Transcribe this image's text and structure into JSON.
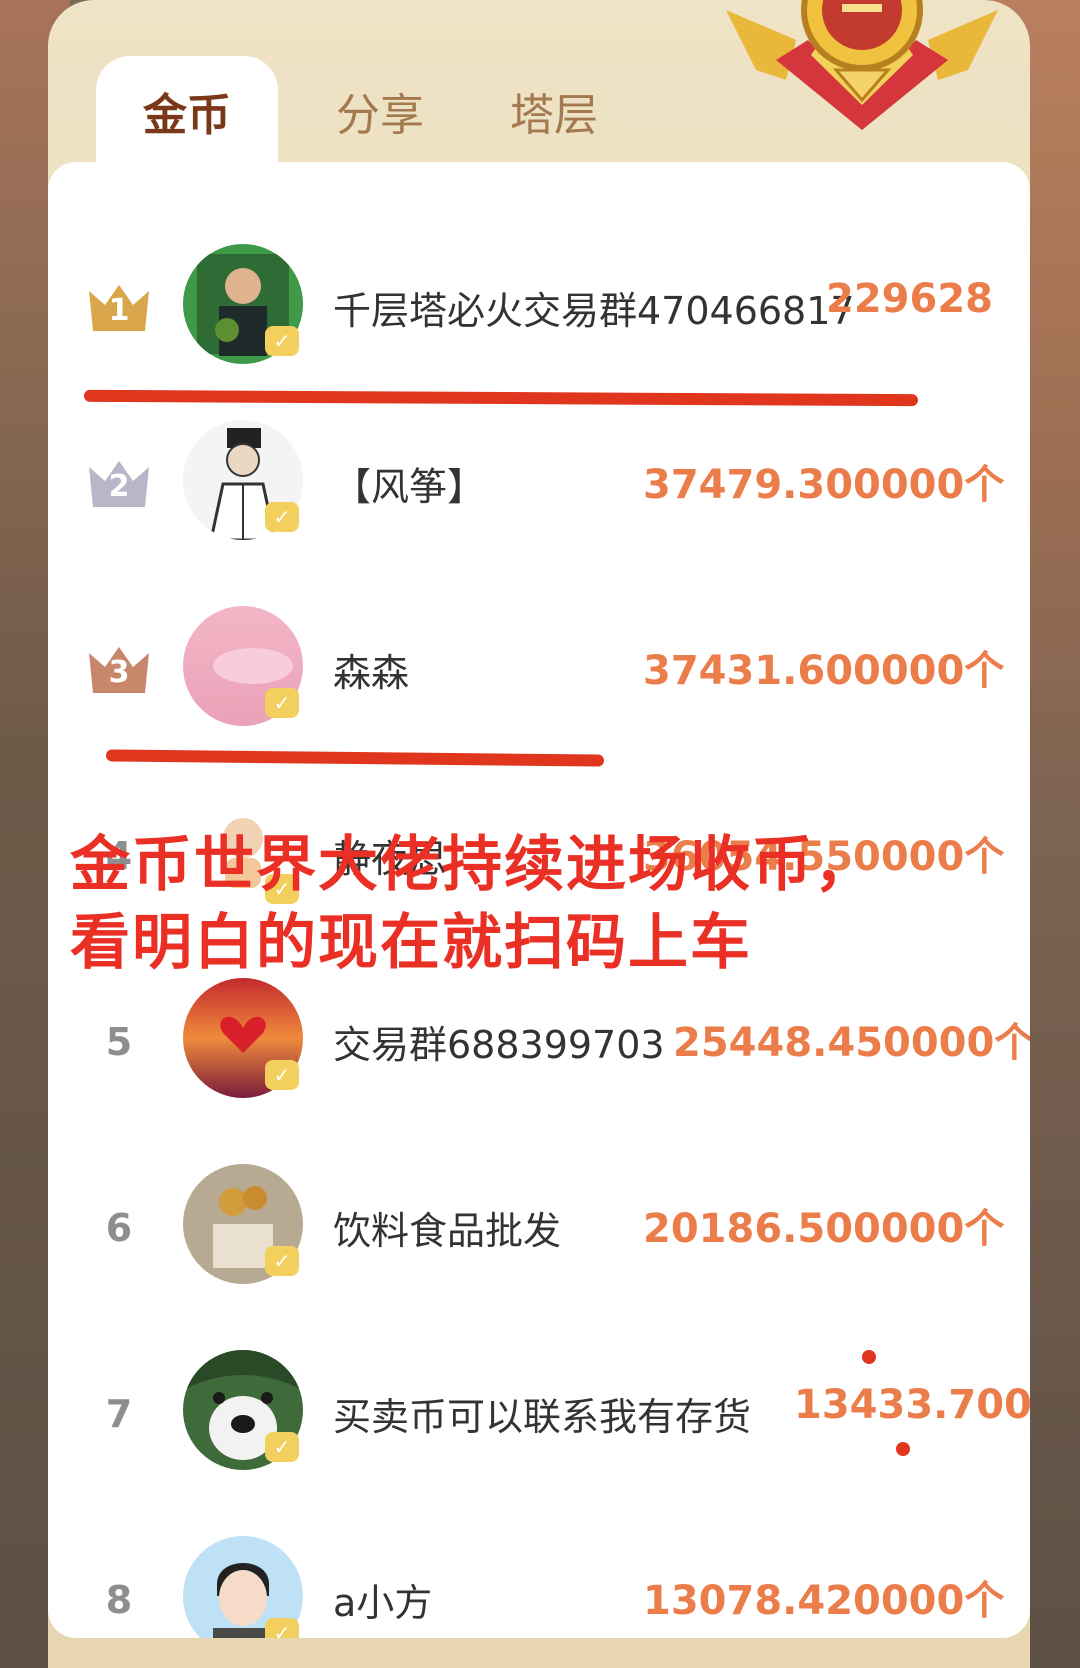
{
  "tabs": [
    {
      "label": "金币",
      "active": true
    },
    {
      "label": "分享",
      "active": false
    },
    {
      "label": "塔层",
      "active": false
    }
  ],
  "rows": [
    {
      "rank": "1",
      "name": "千层塔必火交易群470466817",
      "coins": "229628"
    },
    {
      "rank": "2",
      "name": "【风筝】",
      "coins": "37479.300000个"
    },
    {
      "rank": "3",
      "name": "森森",
      "coins": "37431.600000个"
    },
    {
      "rank": "4",
      "name": "静夜思",
      "coins": "36054.550000个"
    },
    {
      "rank": "5",
      "name": "交易群688399703",
      "coins": "25448.450000个"
    },
    {
      "rank": "6",
      "name": "饮料食品批发",
      "coins": "20186.500000个"
    },
    {
      "rank": "7",
      "name": "买卖币可以联系我有存货",
      "coins": "13433.700"
    },
    {
      "rank": "8",
      "name": "a小方",
      "coins": "13078.420000个"
    }
  ],
  "overlay": {
    "text": "金币世界大佬持续进场收币，看明白的现在就扫码上车"
  },
  "colors": {
    "coin_orange": "#eb7d4a",
    "gold_crown": "#d9a64b",
    "silver_crown": "#b8b6c9",
    "bronze_crown": "#c8876a",
    "annotation_red": "#ea2f24"
  }
}
